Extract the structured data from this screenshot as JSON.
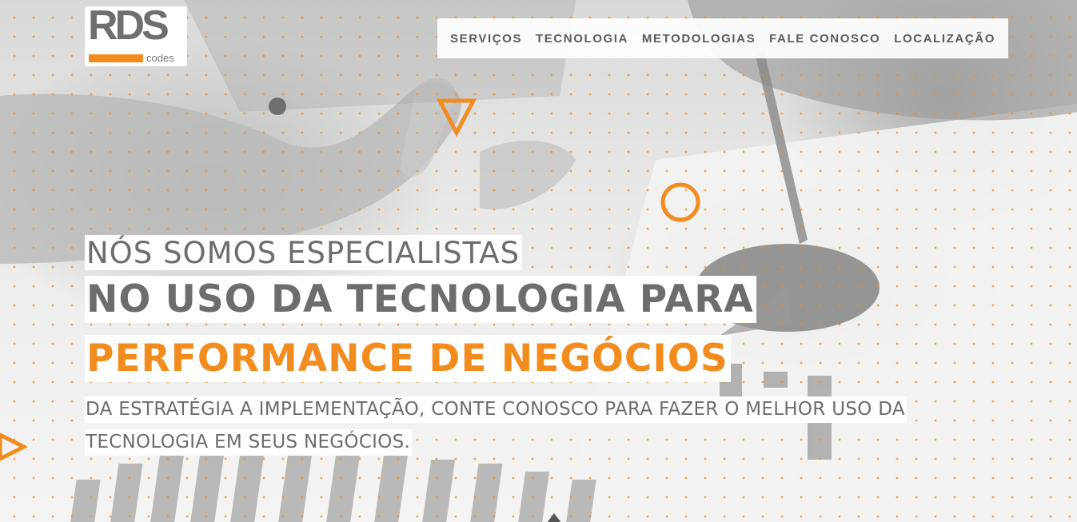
{
  "brand": {
    "logo_text": "RDS",
    "logo_sub": "codes",
    "accent_color": "#f28c1e",
    "text_color": "#6d6d6d"
  },
  "nav": {
    "items": [
      {
        "label": "SERVIÇOS"
      },
      {
        "label": "TECNOLOGIA"
      },
      {
        "label": "METODOLOGIAS"
      },
      {
        "label": "FALE CONOSCO"
      },
      {
        "label": "LOCALIZAÇÃO"
      }
    ]
  },
  "hero": {
    "line1": "NÓS SOMOS ESPECIALISTAS",
    "line2": "NO USO DA TECNOLOGIA PARA",
    "line3": "PERFORMANCE DE NEGÓCIOS",
    "subtitle": "DA ESTRATÉGIA A IMPLEMENTAÇÃO, CONTE CONOSCO PARA FAZER O MELHOR USO DA TECNOLOGIA EM SEUS NEGÓCIOS."
  },
  "icons": {
    "triangle": "orange-triangle-icon",
    "ring": "orange-ring-icon",
    "dot": "gray-dot-icon",
    "arrow": "orange-arrow-icon"
  }
}
